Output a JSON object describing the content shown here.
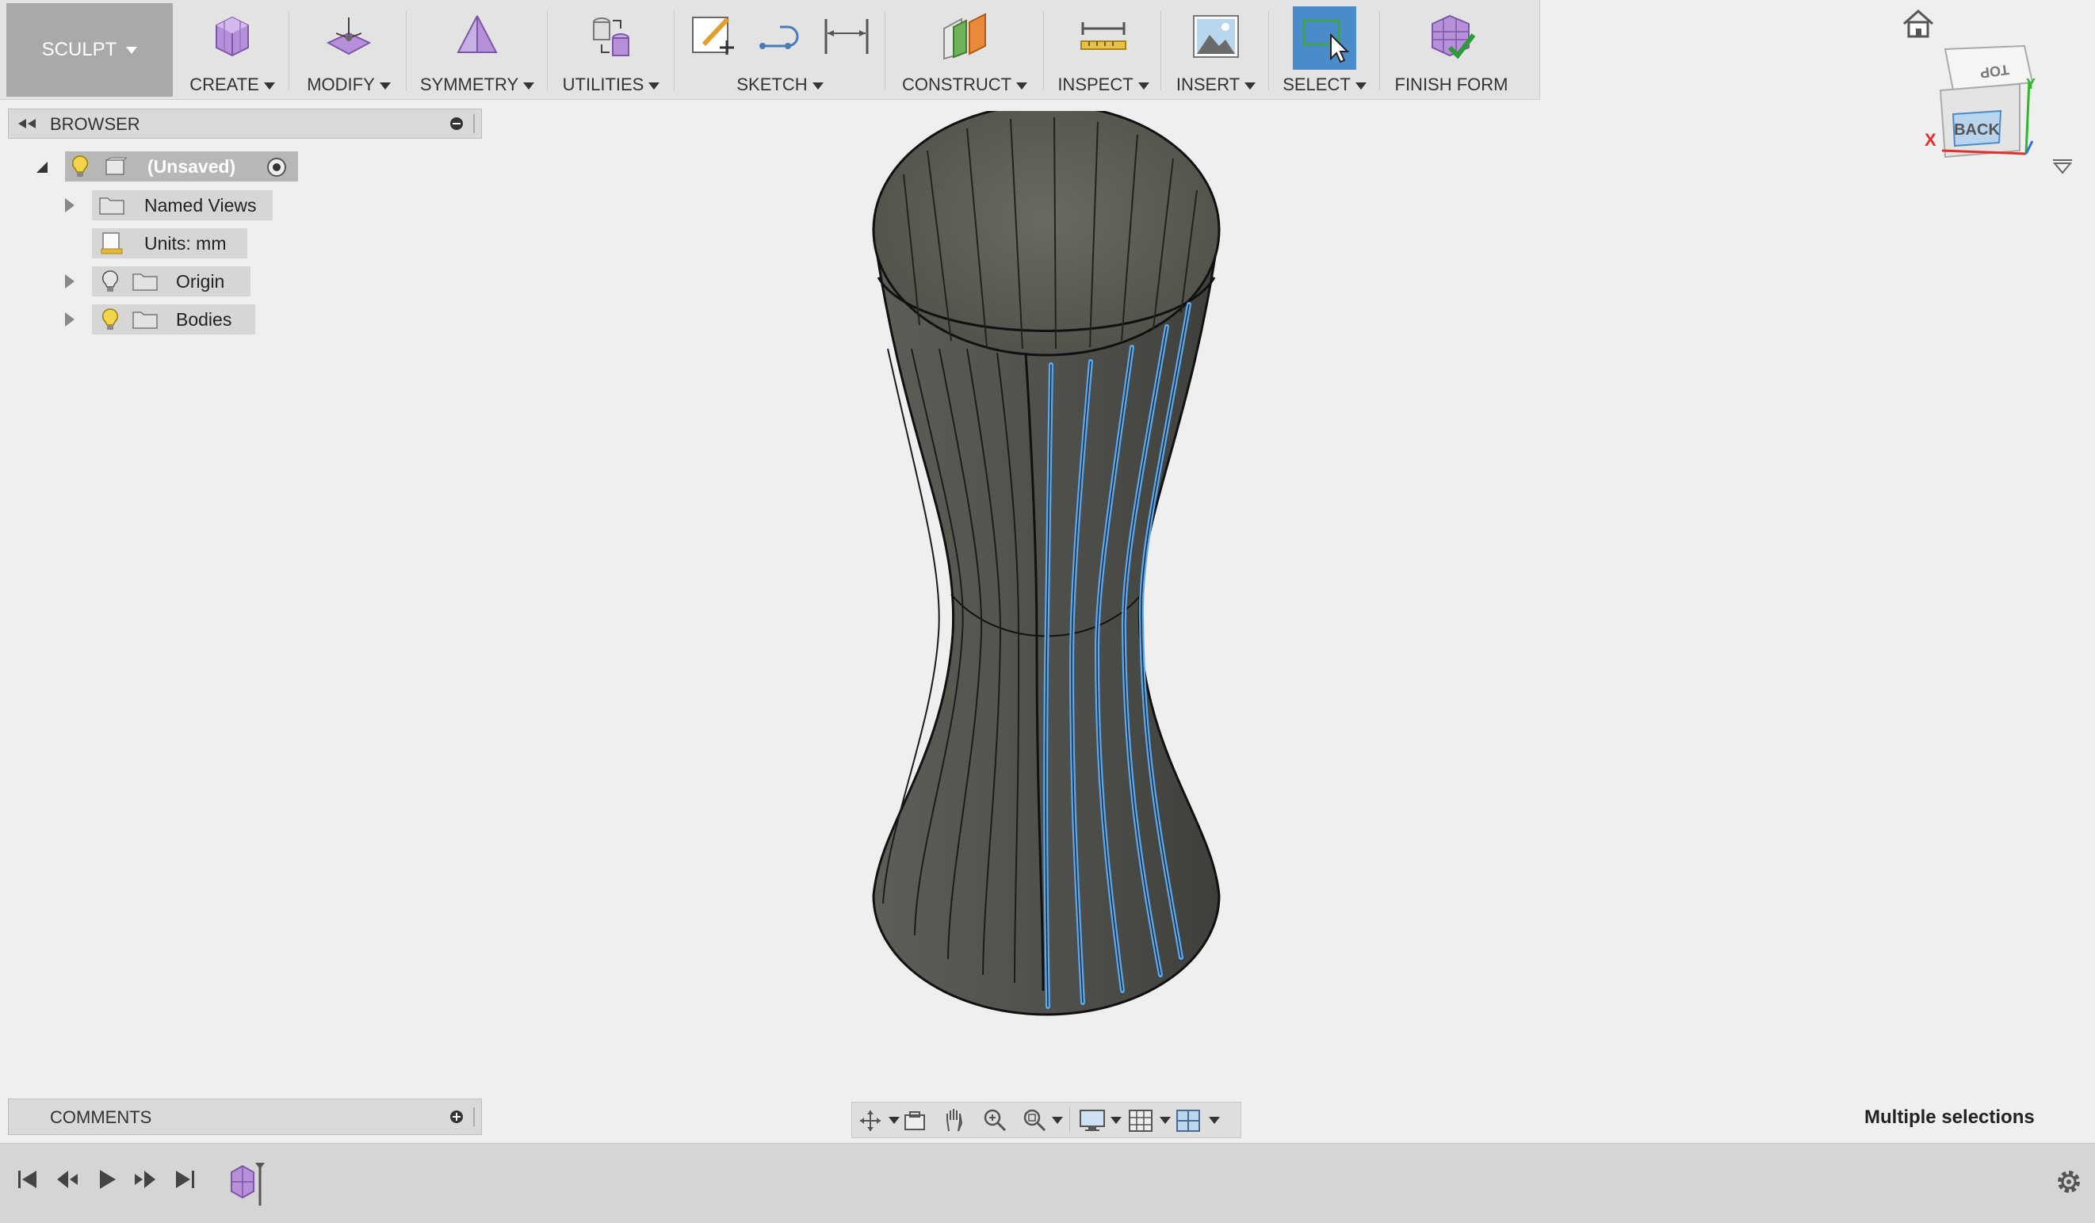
{
  "toolbar": {
    "workspace": "SCULPT",
    "groups": [
      {
        "label": "CREATE",
        "icon": "create-box-icon"
      },
      {
        "label": "MODIFY",
        "icon": "modify-icon"
      },
      {
        "label": "SYMMETRY",
        "icon": "symmetry-icon"
      },
      {
        "label": "UTILITIES",
        "icon": "utilities-icon"
      },
      {
        "label": "SKETCH",
        "icon": "sketch-icon"
      },
      {
        "label": "CONSTRUCT",
        "icon": "construct-plane-icon"
      },
      {
        "label": "INSPECT",
        "icon": "measure-icon"
      },
      {
        "label": "INSERT",
        "icon": "insert-image-icon"
      },
      {
        "label": "SELECT",
        "icon": "select-window-icon"
      },
      {
        "label": "FINISH FORM",
        "icon": "finish-form-icon"
      }
    ]
  },
  "browser": {
    "title": "BROWSER",
    "root": "(Unsaved)",
    "items": [
      "Named Views",
      "Units: mm",
      "Origin",
      "Bodies"
    ]
  },
  "comments": {
    "title": "COMMENTS"
  },
  "viewcube": {
    "top": "TOP",
    "back": "BACK",
    "x": "X",
    "y": "Y"
  },
  "status": {
    "selection": "Multiple selections"
  },
  "colors": {
    "selection_edge": "#5aa9ec",
    "body_fill": "#4a4a46",
    "accent_select": "#4a8cc9"
  }
}
